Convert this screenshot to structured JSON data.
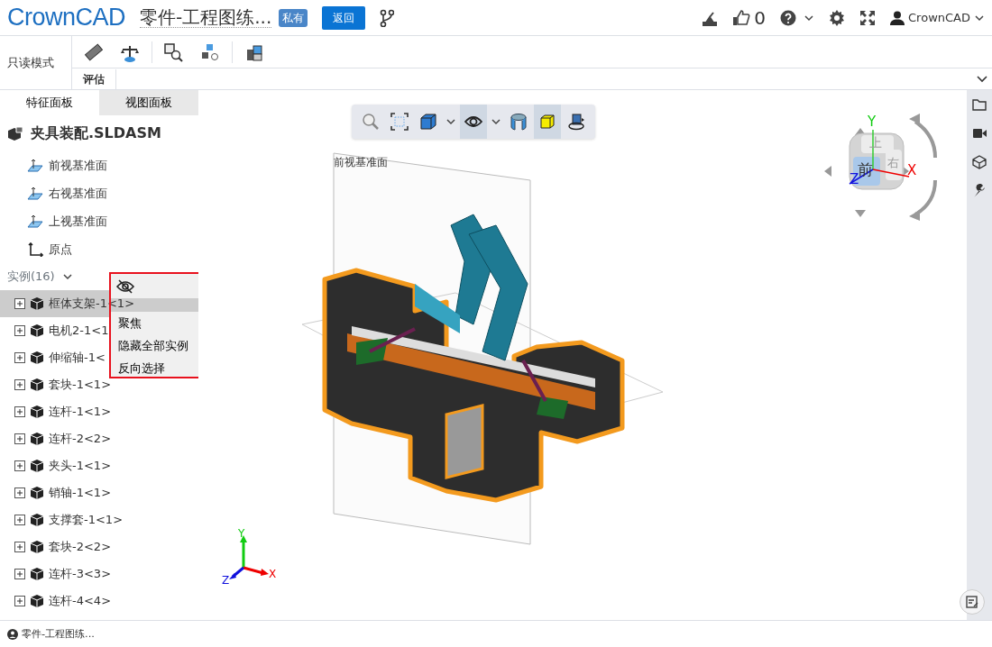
{
  "header": {
    "logo": "CrownCAD",
    "doc_title": "零件-工程图练...",
    "badge": "私有",
    "back_button": "返回",
    "likes": "0",
    "user": "CrownCAD"
  },
  "ribbon": {
    "mode": "只读模式",
    "tabs": [
      {
        "label": "评估",
        "selected": true
      }
    ]
  },
  "panel_tabs": [
    {
      "label": "特征面板",
      "selected": true
    },
    {
      "label": "视图面板",
      "selected": false
    }
  ],
  "tree": {
    "root": "夹具装配.SLDASM",
    "features": [
      {
        "kind": "plane",
        "label": "前视基准面"
      },
      {
        "kind": "plane",
        "label": "右视基准面"
      },
      {
        "kind": "plane",
        "label": "上视基准面"
      },
      {
        "kind": "origin",
        "label": "原点"
      }
    ],
    "instances_header": "实例(16)",
    "expanded": true,
    "instances": [
      {
        "label": "框体支架-1<1>",
        "selected": true
      },
      {
        "label": "电机2-1<1",
        "selected": false
      },
      {
        "label": "伸缩轴-1<",
        "selected": false
      },
      {
        "label": "套块-1<1>",
        "selected": false
      },
      {
        "label": "连杆-1<1>",
        "selected": false
      },
      {
        "label": "连杆-2<2>",
        "selected": false
      },
      {
        "label": "夹头-1<1>",
        "selected": false
      },
      {
        "label": "销轴-1<1>",
        "selected": false
      },
      {
        "label": "支撑套-1<1>",
        "selected": false
      },
      {
        "label": "套块-2<2>",
        "selected": false
      },
      {
        "label": "连杆-3<3>",
        "selected": false
      },
      {
        "label": "连杆-4<4>",
        "selected": false
      }
    ]
  },
  "context_menu": {
    "items": [
      "聚焦",
      "隐藏全部实例",
      "反向选择"
    ]
  },
  "view_toolbar": [
    {
      "kind": "zoom",
      "selected": false
    },
    {
      "kind": "fit",
      "selected": false
    },
    {
      "kind": "display",
      "selected": false,
      "has_menu": true
    },
    {
      "kind": "eye",
      "selected": true,
      "has_menu": true
    },
    {
      "kind": "section",
      "selected": false
    },
    {
      "kind": "appearance",
      "selected": true
    },
    {
      "kind": "rotate",
      "selected": false
    }
  ],
  "viewport": {
    "plane_label": "前视基准面"
  },
  "view_cube": {
    "front": "前",
    "top": "上",
    "right": "右",
    "axes": [
      "X",
      "Y",
      "Z"
    ]
  },
  "triad": {
    "axes": [
      "X",
      "Y",
      "Z"
    ]
  },
  "status_bar": {
    "doc": "零件-工程图练..."
  }
}
